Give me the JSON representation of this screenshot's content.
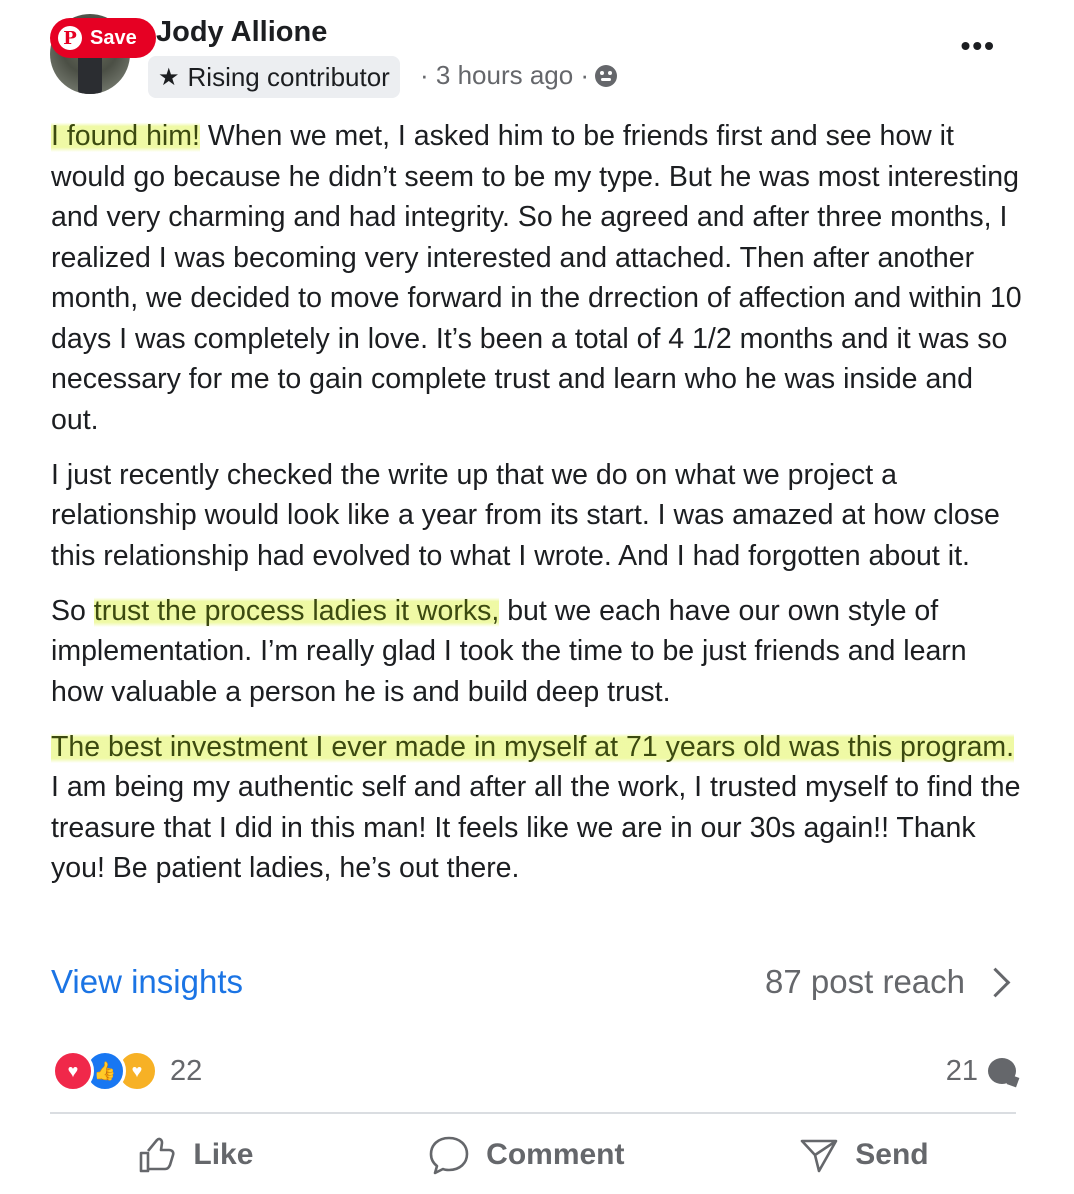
{
  "pin_button": {
    "label": "Save",
    "icon": "pinterest-icon"
  },
  "author": {
    "name": "Jody Allione",
    "badge": "Rising contributor",
    "badge_icon": "star-icon"
  },
  "post_meta": {
    "time": "· 3 hours ago ·",
    "audience_icon": "group-icon"
  },
  "more_label": "•••",
  "body": {
    "p1_hl": "I found him!",
    "p1_rest": " When we met, I asked him to be friends first and see how it would go because he didn’t seem to be my type. But he was most interesting and very charming and had integrity. So he agreed and after three months, I realized I was becoming very interested and attached. Then after another month, we decided to move forward in the drrection of affection and within 10 days I was completely in love. It’s been a total of 4 1/2 months and it was so necessary for me to gain complete trust and learn who he was inside and out.",
    "p2": "I just recently checked the write up that we do on what we project a relationship would look like a year from its start. I was amazed at how close this relationship had evolved to what I wrote. And I had forgotten about it.",
    "p3_pre": "So ",
    "p3_hl": "trust the process ladies it works,",
    "p3_rest": " but we each have our own style of implementation. I’m really glad I took the time to be just friends and learn how valuable a person he is and build deep trust.",
    "p4_hl": "The best investment I ever made in myself at 71 years old was this program.",
    "p4_rest": " I am being my authentic self and after all the work,  I trusted myself to find the treasure that I did in this man! It feels like we are in our 30s again!! Thank you! Be patient ladies, he’s out there."
  },
  "insights": {
    "link": "View insights",
    "reach": "87 post reach"
  },
  "reactions": {
    "count": "22",
    "types": [
      "love",
      "like",
      "care"
    ]
  },
  "comments": {
    "count": "21"
  },
  "actions": {
    "like": "Like",
    "comment": "Comment",
    "send": "Send"
  },
  "colors": {
    "link": "#1b74e4",
    "highlight": "#eef9a0",
    "pinterest": "#e60023",
    "muted": "#65676b"
  }
}
